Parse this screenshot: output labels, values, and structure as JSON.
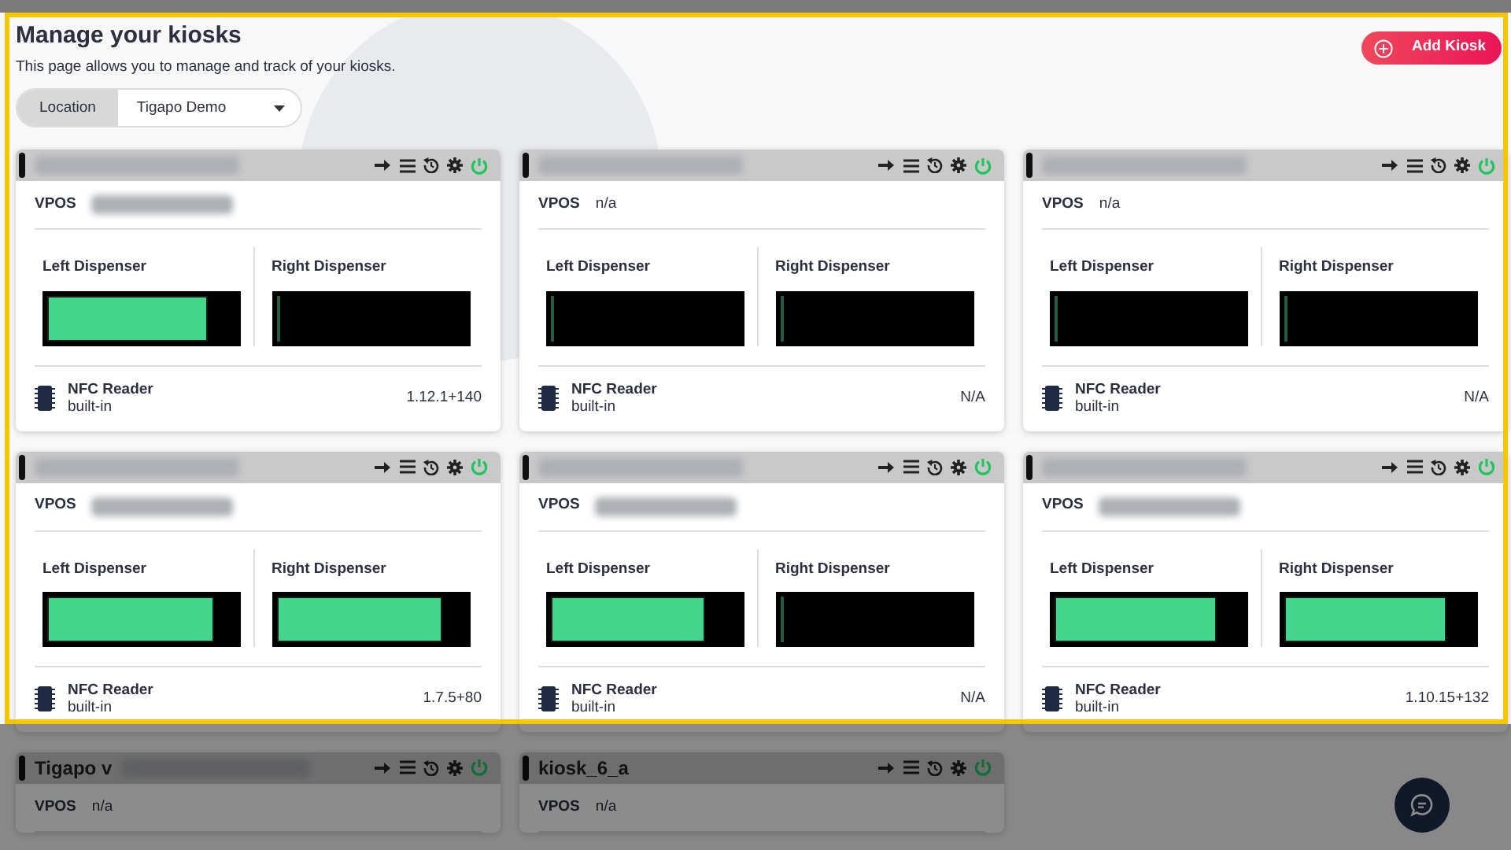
{
  "page": {
    "title": "Manage your kiosks",
    "subtitle": "This page allows you to manage and track of your kiosks."
  },
  "location_filter": {
    "label": "Location",
    "value": "Tigapo Demo"
  },
  "add_button": {
    "label": "Add Kiosk"
  },
  "kiosks": [
    {
      "redacted": true,
      "online": true,
      "vpos": {
        "label": "VPOS",
        "redacted": true
      },
      "dispensers": [
        {
          "label": "Left Dispenser",
          "level": 0.85
        },
        {
          "label": "Right Dispenser",
          "level": 0
        }
      ],
      "reader": {
        "name": "NFC Reader",
        "type": "built-in",
        "version": "1.12.1+140"
      }
    },
    {
      "redacted": true,
      "online": true,
      "vpos": {
        "label": "VPOS",
        "value": "n/a"
      },
      "dispensers": [
        {
          "label": "Left Dispenser",
          "level": 0
        },
        {
          "label": "Right Dispenser",
          "level": 0
        }
      ],
      "reader": {
        "name": "NFC Reader",
        "type": "built-in",
        "version": "N/A"
      }
    },
    {
      "redacted": true,
      "online": true,
      "vpos": {
        "label": "VPOS",
        "value": "n/a"
      },
      "dispensers": [
        {
          "label": "Left Dispenser",
          "level": 0
        },
        {
          "label": "Right Dispenser",
          "level": 0
        }
      ],
      "reader": {
        "name": "NFC Reader",
        "type": "built-in",
        "version": "N/A"
      }
    },
    {
      "redacted": true,
      "online": true,
      "vpos": {
        "label": "VPOS",
        "redacted": true
      },
      "dispensers": [
        {
          "label": "Left Dispenser",
          "level": 0.88
        },
        {
          "label": "Right Dispenser",
          "level": 0.88
        }
      ],
      "reader": {
        "name": "NFC Reader",
        "type": "built-in",
        "version": "1.7.5+80"
      }
    },
    {
      "redacted": true,
      "online": true,
      "vpos": {
        "label": "VPOS",
        "redacted": true
      },
      "dispensers": [
        {
          "label": "Left Dispenser",
          "level": 0.82
        },
        {
          "label": "Right Dispenser",
          "level": 0
        }
      ],
      "reader": {
        "name": "NFC Reader",
        "type": "built-in",
        "version": "N/A"
      }
    },
    {
      "redacted": true,
      "online": true,
      "vpos": {
        "label": "VPOS",
        "redacted": true
      },
      "dispensers": [
        {
          "label": "Left Dispenser",
          "level": 0.86
        },
        {
          "label": "Right Dispenser",
          "level": 0.86
        }
      ],
      "reader": {
        "name": "NFC Reader",
        "type": "built-in",
        "version": "1.10.15+132"
      }
    },
    {
      "title": "Tigapo v",
      "redacted": true,
      "online": true,
      "vpos": {
        "label": "VPOS",
        "value": "n/a"
      }
    },
    {
      "title": "kiosk_6_a",
      "redacted": false,
      "online": true,
      "vpos": {
        "label": "VPOS",
        "value": "n/a"
      }
    }
  ]
}
